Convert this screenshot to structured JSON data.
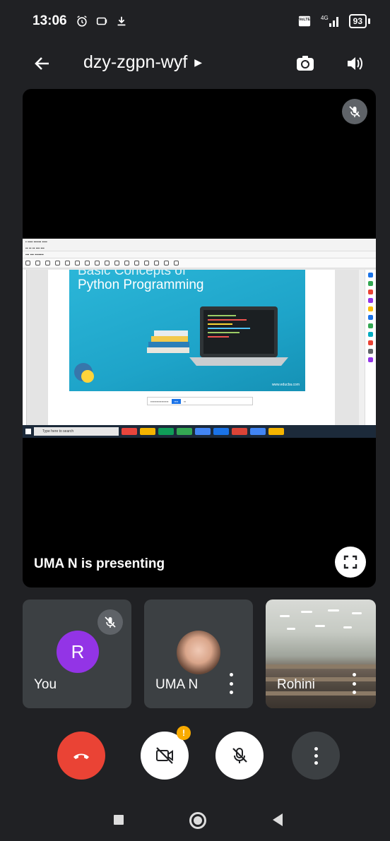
{
  "status_bar": {
    "time": "13:06",
    "network": "4G",
    "battery": "93"
  },
  "header": {
    "title": "dzy-zgpn-wyf"
  },
  "presentation": {
    "label": "UMA N is presenting",
    "slide_title_line1": "Basic Concepts of",
    "slide_title_line2": "Python Programming",
    "slide_url": "www.educba.com",
    "taskbar_search": "Type here to search"
  },
  "participants": [
    {
      "name": "You",
      "initial": "R",
      "muted": true
    },
    {
      "name": "UMA N",
      "muted": false
    },
    {
      "name": "Rohini",
      "muted": false
    }
  ],
  "colors": {
    "end_call": "#ea4335",
    "avatar": "#9334e6",
    "badge": "#f9ab00",
    "background": "#202124"
  }
}
